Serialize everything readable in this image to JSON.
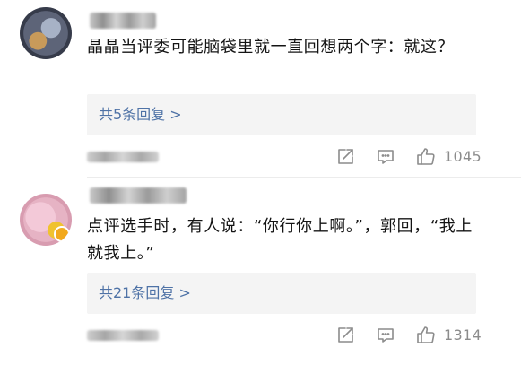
{
  "comments": [
    {
      "text": "晶晶当评委可能脑袋里就一直回想两个字：就这？",
      "replies_label": "共5条回复 >",
      "likes": "1045"
    },
    {
      "text": "点评选手时，有人说：“你行你上啊。”，郭回，“我上就我上。”",
      "replies_label": "共21条回复 >",
      "likes": "1314"
    }
  ],
  "colors": {
    "reply_link": "#4e72a6",
    "action_icon": "#8c8c8c",
    "reply_box_bg": "#f4f4f4"
  },
  "icons": {
    "share": "share-icon",
    "comment": "comment-icon",
    "like": "thumbs-up-icon"
  }
}
